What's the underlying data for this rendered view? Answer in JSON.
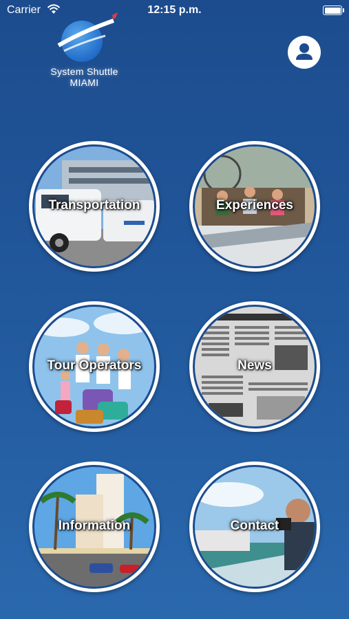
{
  "status_bar": {
    "carrier": "Carrier",
    "time": "12:15 p.m."
  },
  "logo": {
    "line1": "System Shuttle",
    "line2": "MIAMI"
  },
  "profile": {
    "icon": "user-icon"
  },
  "tiles": [
    {
      "label": "Transportation"
    },
    {
      "label": "Experiences"
    },
    {
      "label": "Tour Operators"
    },
    {
      "label": "News"
    },
    {
      "label": "Information"
    },
    {
      "label": "Contact"
    }
  ],
  "colors": {
    "background_top": "#1c4c8e",
    "background_bottom": "#2a68ad",
    "ring": "#ffffff"
  }
}
